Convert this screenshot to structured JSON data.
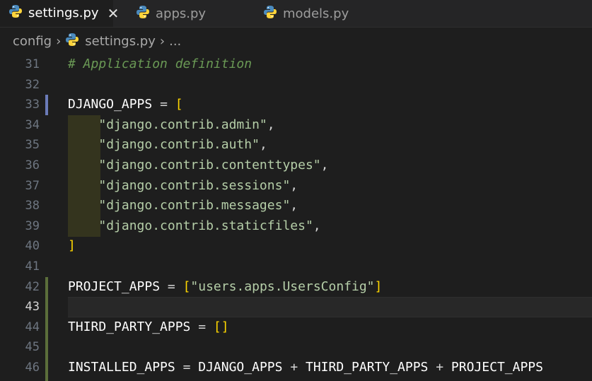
{
  "tabs": [
    {
      "label": "settings.py",
      "active": true,
      "icon": "python-icon",
      "close": "✕"
    },
    {
      "label": "apps.py",
      "active": false,
      "icon": "python-icon"
    },
    {
      "label": "models.py",
      "active": false,
      "icon": "python-icon"
    }
  ],
  "breadcrumb": {
    "folder": "config",
    "file": "settings.py",
    "more": "...",
    "separator": "›"
  },
  "editor": {
    "current_line": 43,
    "lines": [
      {
        "num": "31",
        "text": "# Application definition"
      },
      {
        "num": "32",
        "text": ""
      },
      {
        "num": "33",
        "text": "DJANGO_APPS = ["
      },
      {
        "num": "34",
        "text": "    \"django.contrib.admin\","
      },
      {
        "num": "35",
        "text": "    \"django.contrib.auth\","
      },
      {
        "num": "36",
        "text": "    \"django.contrib.contenttypes\","
      },
      {
        "num": "37",
        "text": "    \"django.contrib.sessions\","
      },
      {
        "num": "38",
        "text": "    \"django.contrib.messages\","
      },
      {
        "num": "39",
        "text": "    \"django.contrib.staticfiles\","
      },
      {
        "num": "40",
        "text": "]"
      },
      {
        "num": "41",
        "text": ""
      },
      {
        "num": "42",
        "text": "PROJECT_APPS = [\"users.apps.UsersConfig\"]"
      },
      {
        "num": "43",
        "text": ""
      },
      {
        "num": "44",
        "text": "THIRD_PARTY_APPS = []"
      },
      {
        "num": "45",
        "text": ""
      },
      {
        "num": "46",
        "text": "INSTALLED_APPS = DJANGO_APPS + THIRD_PARTY_APPS + PROJECT_APPS"
      }
    ]
  },
  "colors": {
    "background": "#1e1e1e",
    "tabbar": "#252526",
    "string": "#ce9178",
    "bracket": "#ffd700",
    "comment": "#6a9955",
    "git_modified": "#6b7bb8",
    "git_added": "#5b6e3a"
  }
}
